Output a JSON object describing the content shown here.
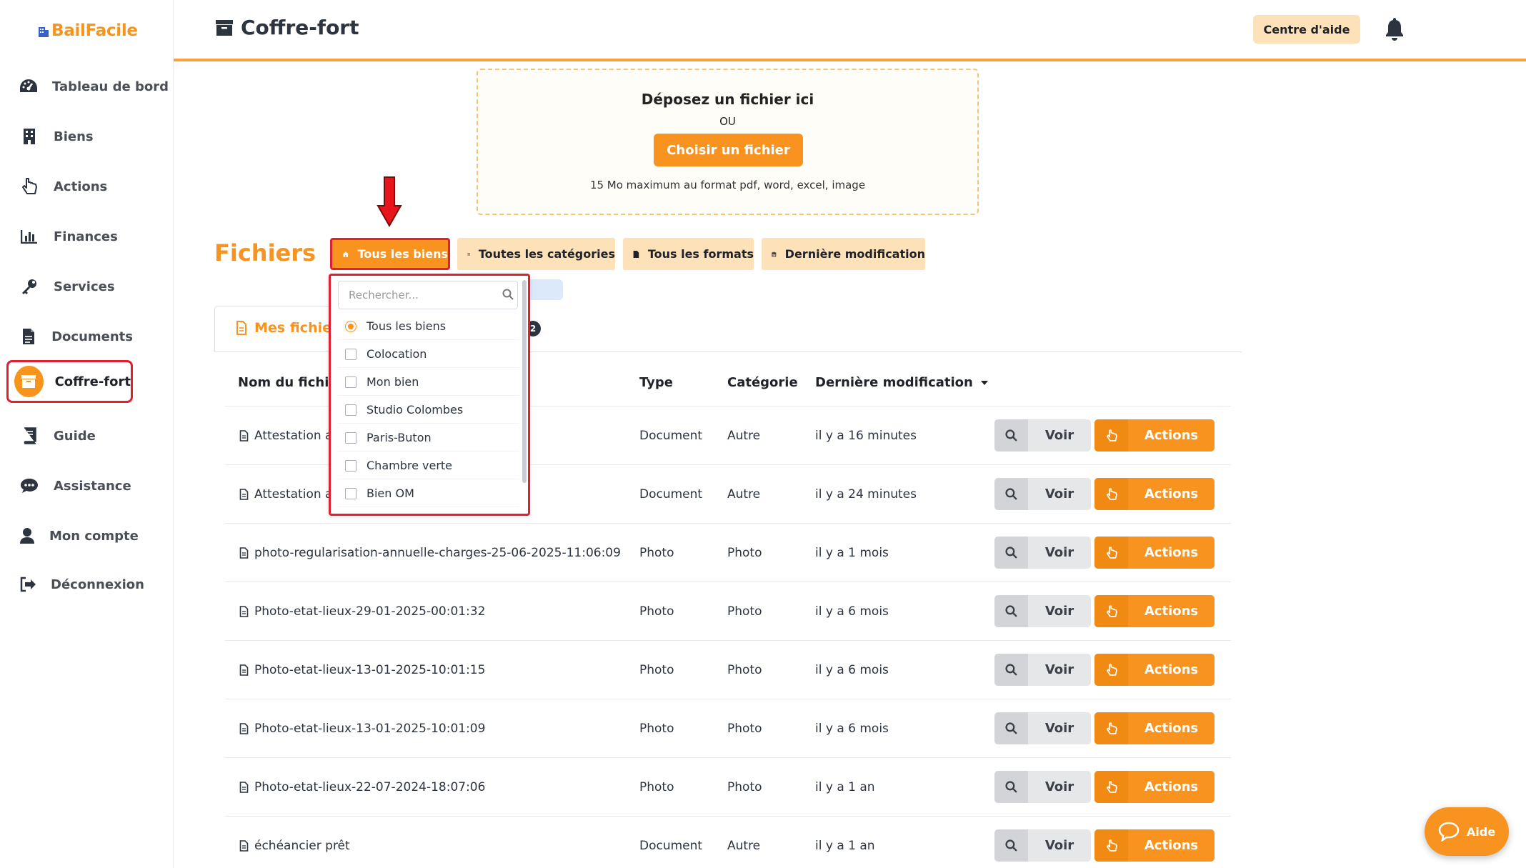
{
  "brand": {
    "name": "BailFacile",
    "color": "#f7941d"
  },
  "colors": {
    "accent": "#f7931e",
    "highlight": "#e02030",
    "soft": "#fde1b8"
  },
  "sidebar": {
    "items": [
      {
        "label": "Tableau de bord",
        "icon": "dashboard-icon"
      },
      {
        "label": "Biens",
        "icon": "building-icon"
      },
      {
        "label": "Actions",
        "icon": "pointer-hand-icon"
      },
      {
        "label": "Finances",
        "icon": "bar-chart-icon"
      },
      {
        "label": "Services",
        "icon": "key-icon"
      },
      {
        "label": "Documents",
        "icon": "document-icon"
      },
      {
        "label": "Coffre-fort",
        "icon": "archive-icon",
        "active": true
      },
      {
        "label": "Guide",
        "icon": "book-icon"
      },
      {
        "label": "Assistance",
        "icon": "chat-icon"
      },
      {
        "label": "Mon compte",
        "icon": "user-icon"
      },
      {
        "label": "Déconnexion",
        "icon": "logout-icon"
      }
    ]
  },
  "header": {
    "title": "Coffre-fort",
    "help_label": "Centre d'aide"
  },
  "upload": {
    "title": "Déposez un fichier ici",
    "or": "OU",
    "button": "Choisir un fichier",
    "hint": "15 Mo maximum au format pdf, word, excel, image"
  },
  "files": {
    "title": "Fichiers",
    "filters": {
      "biens": "Tous les biens",
      "categories": "Toutes les catégories",
      "formats": "Tous les formats",
      "modif": "Dernière modification"
    },
    "tab": {
      "label": "Mes fichier",
      "badge": "2"
    },
    "columns": {
      "name": "Nom du fichier",
      "type": "Type",
      "category": "Catégorie",
      "modified": "Dernière modification"
    },
    "voir_label": "Voir",
    "actions_label": "Actions",
    "rows": [
      {
        "name": "Attestation a",
        "type": "Document",
        "category": "Autre",
        "modified": "il y a 16 minutes"
      },
      {
        "name": "Attestation a",
        "type": "Document",
        "category": "Autre",
        "modified": "il y a 24 minutes"
      },
      {
        "name": "photo-regularisation-annuelle-charges-25-06-2025-11:06:09",
        "type": "Photo",
        "category": "Photo",
        "modified": "il y a 1 mois"
      },
      {
        "name": "Photo-etat-lieux-29-01-2025-00:01:32",
        "type": "Photo",
        "category": "Photo",
        "modified": "il y a 6 mois"
      },
      {
        "name": "Photo-etat-lieux-13-01-2025-10:01:15",
        "type": "Photo",
        "category": "Photo",
        "modified": "il y a 6 mois"
      },
      {
        "name": "Photo-etat-lieux-13-01-2025-10:01:09",
        "type": "Photo",
        "category": "Photo",
        "modified": "il y a 6 mois"
      },
      {
        "name": "Photo-etat-lieux-22-07-2024-18:07:06",
        "type": "Photo",
        "category": "Photo",
        "modified": "il y a 1 an"
      },
      {
        "name": "échéancier prêt",
        "type": "Document",
        "category": "Autre",
        "modified": "il y a 1 an"
      }
    ]
  },
  "dropdown": {
    "search_placeholder": "Rechercher...",
    "options": [
      {
        "label": "Tous les biens",
        "selected": true
      },
      {
        "label": "Colocation",
        "selected": false
      },
      {
        "label": "Mon bien",
        "selected": false
      },
      {
        "label": "Studio Colombes",
        "selected": false
      },
      {
        "label": "Paris-Buton",
        "selected": false
      },
      {
        "label": "Chambre verte",
        "selected": false
      },
      {
        "label": "Bien OM",
        "selected": false
      }
    ]
  },
  "aide": {
    "label": "Aide"
  }
}
